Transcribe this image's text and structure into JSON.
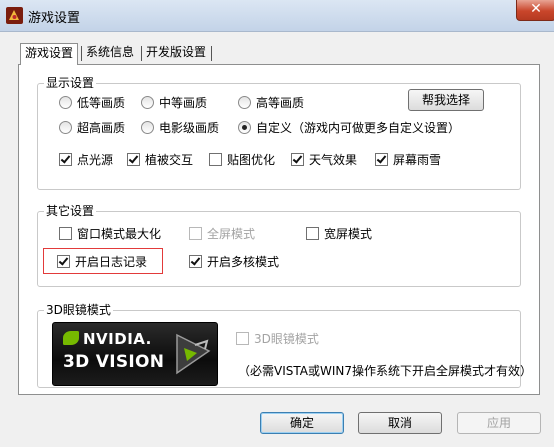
{
  "window": {
    "title": "游戏设置",
    "close_glyph": "✕"
  },
  "tabs": [
    {
      "label": "游戏设置",
      "active": true
    },
    {
      "label": "系统信息",
      "active": false
    },
    {
      "label": "开发版设置",
      "active": false
    }
  ],
  "display": {
    "title": "显示设置",
    "radios": [
      {
        "label": "低等画质",
        "checked": false
      },
      {
        "label": "中等画质",
        "checked": false
      },
      {
        "label": "高等画质",
        "checked": false
      },
      {
        "label": "超高画质",
        "checked": false
      },
      {
        "label": "电影级画质",
        "checked": false
      },
      {
        "label": "自定义（游戏内可做更多自定义设置）",
        "checked": true
      }
    ],
    "help_button": "帮我选择",
    "checks": [
      {
        "label": "点光源",
        "checked": true
      },
      {
        "label": "植被交互",
        "checked": true
      },
      {
        "label": "贴图优化",
        "checked": false
      },
      {
        "label": "天气效果",
        "checked": true
      },
      {
        "label": "屏幕雨雪",
        "checked": true
      }
    ]
  },
  "other": {
    "title": "其它设置",
    "checks": [
      {
        "label": "窗口模式最大化",
        "checked": false,
        "enabled": true
      },
      {
        "label": "全屏模式",
        "checked": false,
        "enabled": false
      },
      {
        "label": "宽屏模式",
        "checked": false,
        "enabled": true
      },
      {
        "label": "开启日志记录",
        "checked": true,
        "enabled": true
      },
      {
        "label": "开启多核模式",
        "checked": true,
        "enabled": true
      }
    ]
  },
  "glasses3d": {
    "title": "3D眼镜模式",
    "logo_brand": "NVIDIA.",
    "logo_product": "3D VISION",
    "check": {
      "label": "3D眼镜模式",
      "checked": false,
      "enabled": false
    },
    "note": "（必需VISTA或WIN7操作系统下开启全屏模式才有效）"
  },
  "footer": {
    "ok": "确定",
    "cancel": "取消",
    "apply": "应用"
  },
  "colors": {
    "highlight": "#e23a3a",
    "nvidia_green": "#76b900"
  },
  "icons": {
    "app": "game-app-icon",
    "close": "close-icon"
  }
}
